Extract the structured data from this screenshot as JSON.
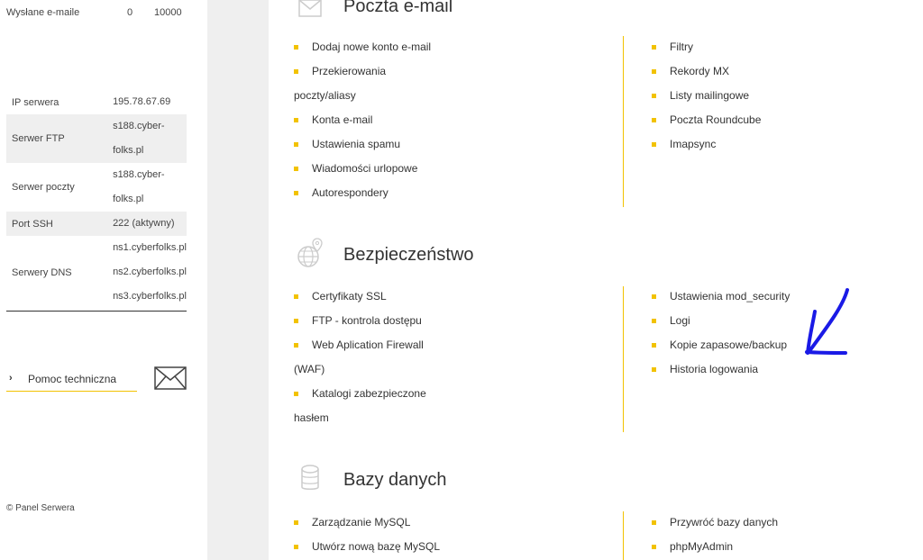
{
  "sidebar": {
    "sent_emails": {
      "label": "Wysłane e-maile",
      "used": "0",
      "limit": "10000"
    },
    "server_info": {
      "ip": {
        "label": "IP serwera",
        "value": "195.78.67.69"
      },
      "ftp": {
        "label": "Serwer FTP",
        "value_line1": "s188.cyber-",
        "value_line2": "folks.pl"
      },
      "mail": {
        "label": "Serwer poczty",
        "value_line1": "s188.cyber-",
        "value_line2": "folks.pl"
      },
      "ssh": {
        "label": "Port SSH",
        "value": "222 (aktywny)"
      },
      "dns": {
        "label": "Serwery DNS",
        "values": [
          "ns1.cyberfolks.pl",
          "ns2.cyberfolks.pl",
          "ns3.cyberfolks.pl"
        ]
      }
    },
    "help_label": "Pomoc techniczna",
    "copyright": "© Panel Serwera"
  },
  "sections": {
    "email": {
      "title": "Poczta e-mail",
      "left": {
        "add_account": "Dodaj nowe konto e-mail",
        "forwarding_line1": "Przekierowania",
        "forwarding_line2": "poczty/aliasy",
        "accounts": "Konta e-mail",
        "spam": "Ustawienia spamu",
        "vacation": "Wiadomości urlopowe",
        "autoresponders": "Autorespondery"
      },
      "right": [
        "Filtry",
        "Rekordy MX",
        "Listy mailingowe",
        "Poczta Roundcube",
        "Imapsync"
      ]
    },
    "security": {
      "title": "Bezpieczeństwo",
      "left": {
        "ssl": "Certyfikaty SSL",
        "ftp": "FTP - kontrola dostępu",
        "waf_line1": "Web Aplication Firewall",
        "waf_line2": "(WAF)",
        "dirs_line1": "Katalogi zabezpieczone",
        "dirs_line2": "hasłem"
      },
      "right": [
        "Ustawienia mod_security",
        "Logi",
        "Kopie zapasowe/backup",
        "Historia logowania"
      ]
    },
    "databases": {
      "title": "Bazy danych",
      "left": [
        "Zarządzanie MySQL",
        "Utwórz nową bazę MySQL"
      ],
      "right": [
        "Przywróć bazy danych",
        "phpMyAdmin"
      ]
    }
  },
  "colors": {
    "accent": "#f2c200",
    "annotation": "#1a1ae6"
  }
}
